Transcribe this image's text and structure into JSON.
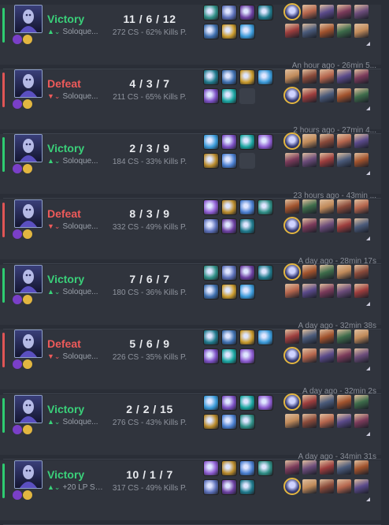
{
  "icons": {
    "champion": "champion-portrait-icon",
    "spell": "summoner-spell-icon",
    "item": "item-icon",
    "participant": "participant-champion-icon",
    "expand": "expand-triangle-icon"
  },
  "colors": {
    "win": "#3ad17a",
    "loss": "#ee5a5a",
    "highlight": "#e2b640"
  },
  "matches": [
    {
      "result": "Victory",
      "outcome": "win",
      "timestamp": "",
      "queue": "Soloque...",
      "kda": "11 / 6 / 12",
      "stats": "272 CS - 62% Kills P.",
      "item_count": 7
    },
    {
      "result": "Defeat",
      "outcome": "loss",
      "timestamp": "An hour ago - 26min 5...",
      "queue": "Soloque...",
      "kda": "4 / 3 / 7",
      "stats": "211 CS - 65% Kills P.",
      "item_count": 6
    },
    {
      "result": "Victory",
      "outcome": "win",
      "timestamp": "2 hours ago - 27min 4...",
      "queue": "Soloque...",
      "kda": "2 / 3 / 9",
      "stats": "184 CS - 33% Kills P.",
      "item_count": 6
    },
    {
      "result": "Defeat",
      "outcome": "loss",
      "timestamp": "23 hours ago - 43min ...",
      "queue": "Soloque...",
      "kda": "8 / 3 / 9",
      "stats": "332 CS - 49% Kills P.",
      "item_count": 7
    },
    {
      "result": "Victory",
      "outcome": "win",
      "timestamp": "A day ago - 28min 17s",
      "queue": "Soloque...",
      "kda": "7 / 6 / 7",
      "stats": "180 CS - 36% Kills P.",
      "item_count": 7
    },
    {
      "result": "Defeat",
      "outcome": "loss",
      "timestamp": "A day ago - 32min 38s",
      "queue": "Soloque...",
      "kda": "5 / 6 / 9",
      "stats": "226 CS - 35% Kills P.",
      "item_count": 7
    },
    {
      "result": "Victory",
      "outcome": "win",
      "timestamp": "A day ago - 32min 2s",
      "queue": "Soloque...",
      "kda": "2 / 2 / 15",
      "stats": "276 CS - 43% Kills P.",
      "item_count": 7
    },
    {
      "result": "Victory",
      "outcome": "win",
      "timestamp": "A day ago - 34min 31s",
      "queue": "+20 LP Soloq...",
      "kda": "10 / 1 / 7",
      "stats": "317 CS - 49% Kills P.",
      "item_count": 7
    }
  ]
}
